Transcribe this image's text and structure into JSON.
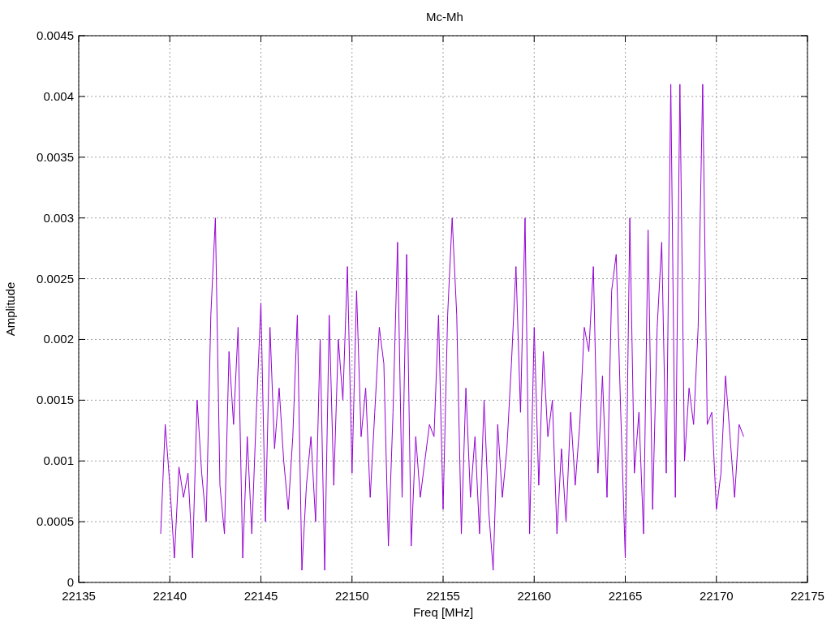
{
  "chart_data": {
    "type": "line",
    "title": "Mc-Mh",
    "xlabel": "Freq [MHz]",
    "ylabel": "Amplitude",
    "xlim": [
      22135,
      22175
    ],
    "ylim": [
      0,
      0.0045
    ],
    "xticks": [
      22135,
      22140,
      22145,
      22150,
      22155,
      22160,
      22165,
      22170,
      22175
    ],
    "yticks": [
      0,
      0.0005,
      0.001,
      0.0015,
      0.002,
      0.0025,
      0.003,
      0.0035,
      0.004,
      0.0045
    ],
    "x": [
      22139.5,
      22139.75,
      22140,
      22140.25,
      22140.5,
      22140.75,
      22141,
      22141.25,
      22141.5,
      22141.75,
      22142,
      22142.25,
      22142.5,
      22142.75,
      22143,
      22143.25,
      22143.5,
      22143.75,
      22144,
      22144.25,
      22144.5,
      22144.75,
      22145,
      22145.25,
      22145.5,
      22145.75,
      22146,
      22146.25,
      22146.5,
      22146.75,
      22147,
      22147.25,
      22147.5,
      22147.75,
      22148,
      22148.25,
      22148.5,
      22148.75,
      22149,
      22149.25,
      22149.5,
      22149.75,
      22150,
      22150.25,
      22150.5,
      22150.75,
      22151,
      22151.25,
      22151.5,
      22151.75,
      22152,
      22152.25,
      22152.5,
      22152.75,
      22153,
      22153.25,
      22153.5,
      22153.75,
      22154,
      22154.25,
      22154.5,
      22154.75,
      22155,
      22155.25,
      22155.5,
      22155.75,
      22156,
      22156.25,
      22156.5,
      22156.75,
      22157,
      22157.25,
      22157.5,
      22157.75,
      22158,
      22158.25,
      22158.5,
      22158.75,
      22159,
      22159.25,
      22159.5,
      22159.75,
      22160,
      22160.25,
      22160.5,
      22160.75,
      22161,
      22161.25,
      22161.5,
      22161.75,
      22162,
      22162.25,
      22162.5,
      22162.75,
      22163,
      22163.25,
      22163.5,
      22163.75,
      22164,
      22164.25,
      22164.5,
      22164.75,
      22165,
      22165.25,
      22165.5,
      22165.75,
      22166,
      22166.25,
      22166.5,
      22166.75,
      22167,
      22167.25,
      22167.5,
      22167.75,
      22168,
      22168.25,
      22168.5,
      22168.75,
      22169,
      22169.25,
      22169.5,
      22169.75,
      22170,
      22170.25,
      22170.5,
      22170.75,
      22171,
      22171.25,
      22171.5
    ],
    "grid": true,
    "series": [
      {
        "color": "#9400d3",
        "values": [
          0.0004,
          0.0013,
          0.0008,
          0.0002,
          0.00095,
          0.0007,
          0.0009,
          0.0002,
          0.0015,
          0.0009,
          0.0005,
          0.0022,
          0.003,
          0.0008,
          0.0004,
          0.0019,
          0.0013,
          0.0021,
          0.0002,
          0.0012,
          0.0004,
          0.0014,
          0.0023,
          0.0005,
          0.0021,
          0.0011,
          0.0016,
          0.001,
          0.0006,
          0.0012,
          0.0022,
          0.0001,
          0.0008,
          0.0012,
          0.0005,
          0.002,
          0.0001,
          0.0022,
          0.0008,
          0.002,
          0.0015,
          0.0026,
          0.0009,
          0.0024,
          0.0012,
          0.0016,
          0.0007,
          0.0014,
          0.0021,
          0.0018,
          0.0003,
          0.0014,
          0.0028,
          0.0007,
          0.0027,
          0.0003,
          0.0012,
          0.0007,
          0.001,
          0.0013,
          0.0012,
          0.0022,
          0.0006,
          0.0022,
          0.003,
          0.0022,
          0.0004,
          0.0016,
          0.0007,
          0.0012,
          0.0004,
          0.0015,
          0.0006,
          0.0001,
          0.0013,
          0.0007,
          0.0011,
          0.0018,
          0.0026,
          0.0014,
          0.003,
          0.0004,
          0.0021,
          0.0008,
          0.0019,
          0.0012,
          0.0015,
          0.0004,
          0.0011,
          0.0005,
          0.0014,
          0.0008,
          0.0013,
          0.0021,
          0.0019,
          0.0026,
          0.0009,
          0.0017,
          0.0007,
          0.0024,
          0.0027,
          0.0014,
          0.0002,
          0.003,
          0.0009,
          0.0014,
          0.0004,
          0.0029,
          0.0006,
          0.0021,
          0.0028,
          0.0009,
          0.0041,
          0.0007,
          0.0041,
          0.001,
          0.0016,
          0.0013,
          0.0021,
          0.0041,
          0.0013,
          0.0014,
          0.0006,
          0.0009,
          0.0017,
          0.0012,
          0.0007,
          0.0013,
          0.0012
        ]
      }
    ]
  }
}
